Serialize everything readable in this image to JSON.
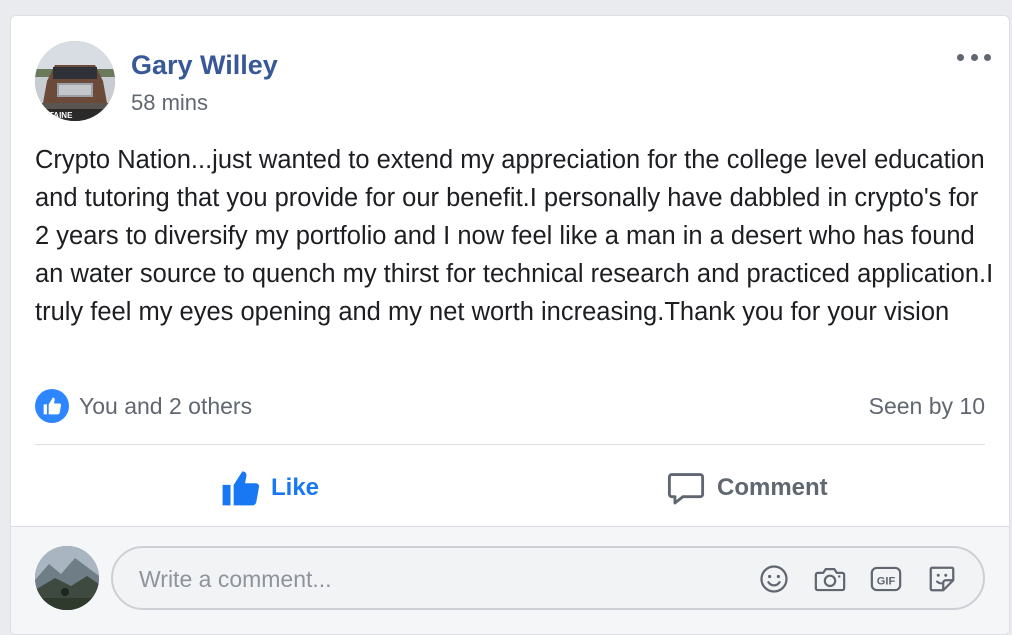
{
  "post": {
    "author": "Gary Willey",
    "time": "58 mins",
    "avatar_caption": "ONTAINE",
    "text": "Crypto Nation...just wanted to extend my appreciation for the college level education and tutoring that you provide for our benefit.I personally have dabbled in crypto's for 2 years to diversify my portfolio and I now feel like a man in a desert who has found an water source to quench my thirst for technical research and practiced application.I truly feel my eyes opening and my net worth increasing.Thank you for your vision"
  },
  "reactions": {
    "likes_text": "You and 2 others",
    "seen_text": "Seen by 10",
    "icon": "like-thumb-icon"
  },
  "actions": {
    "like_label": "Like",
    "comment_label": "Comment"
  },
  "composer": {
    "placeholder": "Write a comment...",
    "value": "",
    "icons": [
      "emoji-icon",
      "camera-icon",
      "gif-icon",
      "sticker-icon"
    ]
  },
  "colors": {
    "accent": "#1877f2",
    "author_link": "#385898",
    "secondary_text": "#606770",
    "body_text": "#1c1e21",
    "like_badge": "#2d86ff"
  }
}
